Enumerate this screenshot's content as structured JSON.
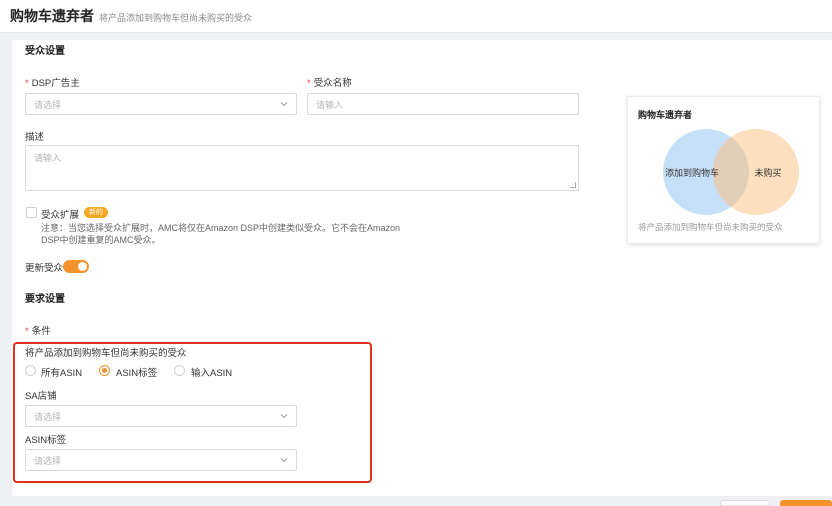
{
  "header": {
    "title": "购物车遗弃者",
    "subtitle": "将产品添加到购物车但尚未购买的受众"
  },
  "audience_settings": {
    "section_title": "受众设置",
    "dsp_label": "DSP广告主",
    "dsp_placeholder": "请选择",
    "name_label": "受众名称",
    "name_placeholder": "请输入",
    "desc_label": "描述",
    "desc_placeholder": "请输入",
    "expand_label": "受众扩展",
    "expand_badge": "新的",
    "expand_note_line1": "注意：当您选择受众扩展时，AMC将仅在Amazon DSP中创建类似受众。它不会在Amazon",
    "expand_note_line2": "DSP中创建重复的AMC受众。",
    "refresh_label": "更新受众",
    "refresh_on": true
  },
  "requirements": {
    "section_title": "要求设置",
    "condition_label": "条件",
    "condition_title": "将产品添加到购物车但尚未购买的受众",
    "radio_options": [
      "所有ASIN",
      "ASIN标签",
      "输入ASIN"
    ],
    "radio_selected": 1,
    "sa_store_label": "SA店铺",
    "sa_store_placeholder": "请选择",
    "asin_tag_label": "ASIN标签",
    "asin_tag_placeholder": "请选择"
  },
  "preview_card": {
    "title": "购物车遗弃者",
    "circle_left": "添加到购物车",
    "circle_right": "未购买",
    "description": "将产品添加到购物车但尚未购买的受众",
    "left_color": "#bfdcf7",
    "right_color": "#fbd9b4"
  },
  "colors": {
    "accent": "#f5922b",
    "highlight_border": "#e0301e"
  },
  "icons": {
    "select_arrow": "chevron-down-icon"
  }
}
